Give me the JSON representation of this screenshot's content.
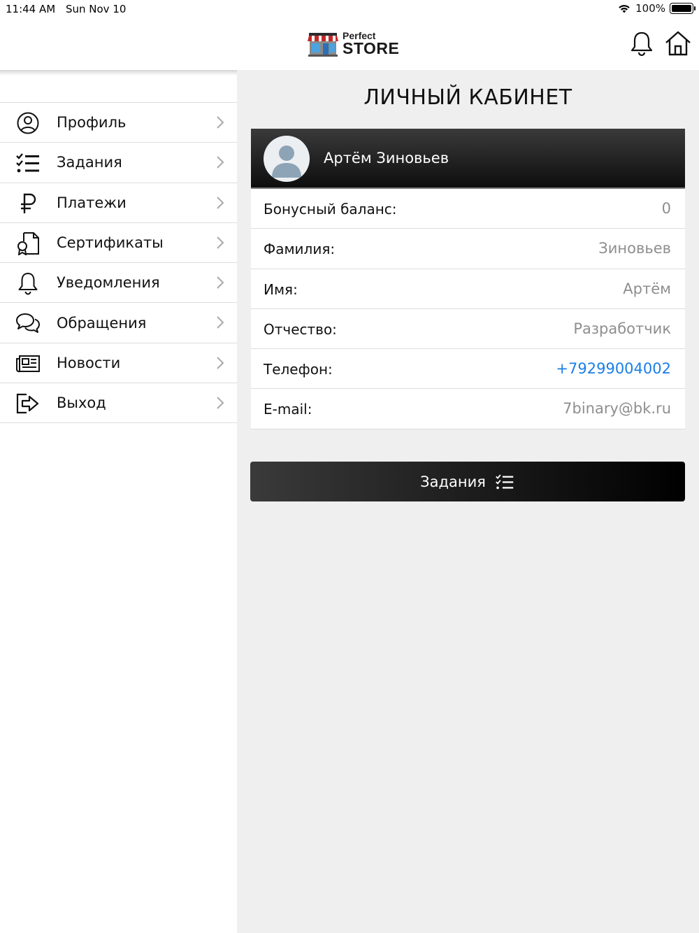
{
  "status_bar": {
    "time": "11:44 AM",
    "date": "Sun Nov 10",
    "battery": "100%",
    "battery_level": 1.0,
    "icons": [
      "wifi-icon",
      "battery-icon"
    ]
  },
  "header": {
    "logo_small": "Perfect",
    "logo_big": "STORE",
    "icons": [
      "bell-icon",
      "home-icon"
    ]
  },
  "sidebar": {
    "items": [
      {
        "label": "Профиль",
        "icon": "user-circle-icon"
      },
      {
        "label": "Задания",
        "icon": "checklist-icon"
      },
      {
        "label": "Платежи",
        "icon": "ruble-icon"
      },
      {
        "label": "Сертификаты",
        "icon": "certificate-icon"
      },
      {
        "label": "Уведомления",
        "icon": "bell-icon"
      },
      {
        "label": "Обращения",
        "icon": "chat-bubbles-icon"
      },
      {
        "label": "Новости",
        "icon": "newspaper-icon"
      },
      {
        "label": "Выход",
        "icon": "logout-icon"
      }
    ]
  },
  "main": {
    "title": "ЛИЧНЫЙ КАБИНЕТ",
    "user_name": "Артём Зиновьев",
    "fields": [
      {
        "label": "Бонусный баланс:",
        "value": "0"
      },
      {
        "label": "Фамилия:",
        "value": "Зиновьев"
      },
      {
        "label": "Имя:",
        "value": "Артём"
      },
      {
        "label": "Отчество:",
        "value": "Разработчик"
      },
      {
        "label": "Телефон:",
        "value": "+79299004002"
      },
      {
        "label": "E-mail:",
        "value": "7binary@bk.ru"
      }
    ],
    "tasks_button": "Задания"
  },
  "colors": {
    "link": "#1a7fe6",
    "header_dark": "#1a1a1a",
    "background": "#efeff0"
  }
}
